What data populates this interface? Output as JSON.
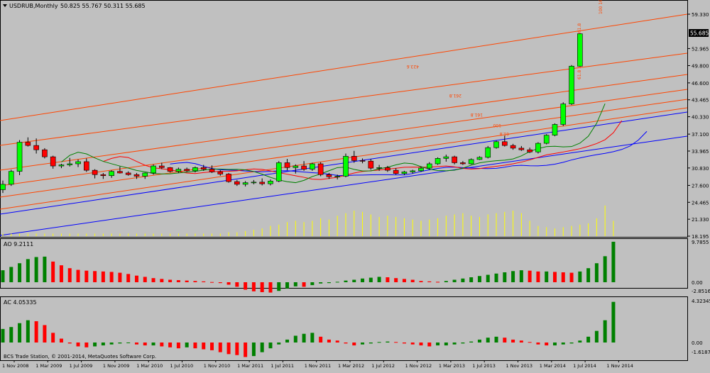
{
  "panels": {
    "main": {
      "title": "USDRUB,Monthly",
      "ohlc": "50.825 55.767 50.311 55.685"
    },
    "ao": {
      "title": "AO 9.2111"
    },
    "ac": {
      "title": "AC 4.05335"
    }
  },
  "axes": {
    "main_ticks": [
      "59.330",
      "55.685",
      "52.965",
      "49.800",
      "46.600",
      "43.465",
      "40.330",
      "37.100",
      "33.965",
      "30.830",
      "27.600",
      "24.465",
      "21.330",
      "18.195"
    ],
    "ao_ticks": [
      "9.7855",
      "0.00",
      "-2.8516"
    ],
    "ac_ticks": [
      "4.32345",
      "0.00",
      "-1.61871"
    ],
    "current_price": "55.685",
    "x_ticks": [
      "1 Nov 2008",
      "1 Mar 2009",
      "1 Jul 2009",
      "1 Nov 2009",
      "1 Mar 2010",
      "1 Jul 2010",
      "1 Nov 2010",
      "1 Mar 2011",
      "1 Jul 2011",
      "1 Nov 2011",
      "1 Mar 2012",
      "1 Jul 2012",
      "1 Nov 2012",
      "1 Mar 2013",
      "1 Jul 2013",
      "1 Nov 2013",
      "1 Mar 2014",
      "1 Jul 2014",
      "1 Nov 2014"
    ]
  },
  "fib_labels": [
    "423.6",
    "261.8",
    "161.8",
    "100",
    "61.8",
    "261.8",
    "161.8",
    "100",
    "61.8",
    "100 161.8 261.8"
  ],
  "copyright": "BCS Trade Station, © 2001-2014, MetaQuotes Software Corp.",
  "colors": {
    "bull": "#00ff00",
    "bear": "#ff0000",
    "fib": "#ff4500",
    "blue": "#0000ff",
    "volume": "#ffff00",
    "ao_up": "#008000",
    "ao_down": "#ff0000"
  },
  "chart_data": {
    "type": "candlestick",
    "months_shown": 74,
    "candles": [
      [
        26.8,
        28.5,
        26.2,
        27.8
      ],
      [
        27.8,
        30.5,
        27.5,
        30.2
      ],
      [
        30.2,
        36.0,
        29.5,
        35.6
      ],
      [
        35.6,
        36.5,
        34.8,
        35.0
      ],
      [
        35.0,
        36.3,
        33.5,
        34.2
      ],
      [
        34.2,
        34.5,
        32.6,
        32.9
      ],
      [
        32.9,
        33.1,
        30.7,
        31.2
      ],
      [
        31.2,
        31.6,
        30.8,
        31.4
      ],
      [
        31.4,
        32.7,
        31.1,
        31.6
      ],
      [
        31.6,
        32.4,
        31.0,
        32.0
      ],
      [
        32.0,
        32.6,
        30.1,
        30.4
      ],
      [
        30.4,
        30.6,
        28.9,
        29.6
      ],
      [
        29.6,
        29.9,
        28.8,
        29.4
      ],
      [
        29.4,
        30.4,
        29.0,
        30.2
      ],
      [
        30.2,
        31.1,
        29.8,
        29.9
      ],
      [
        29.9,
        30.2,
        29.4,
        29.6
      ],
      [
        29.6,
        29.9,
        28.8,
        29.3
      ],
      [
        29.3,
        30.0,
        28.8,
        29.9
      ],
      [
        29.9,
        31.5,
        29.6,
        31.2
      ],
      [
        31.2,
        31.8,
        30.6,
        30.9
      ],
      [
        30.9,
        31.0,
        30.0,
        30.2
      ],
      [
        30.2,
        30.9,
        29.9,
        30.6
      ],
      [
        30.6,
        30.9,
        30.1,
        30.3
      ],
      [
        30.3,
        31.1,
        30.0,
        30.9
      ],
      [
        30.9,
        31.4,
        30.3,
        30.6
      ],
      [
        30.6,
        31.3,
        29.9,
        30.1
      ],
      [
        30.1,
        30.4,
        29.4,
        29.7
      ],
      [
        29.7,
        29.9,
        28.1,
        28.3
      ],
      [
        28.3,
        28.6,
        27.5,
        27.8
      ],
      [
        27.8,
        28.4,
        27.4,
        28.1
      ],
      [
        28.1,
        28.6,
        27.8,
        28.2
      ],
      [
        28.2,
        28.9,
        27.6,
        27.9
      ],
      [
        27.9,
        28.7,
        27.6,
        28.4
      ],
      [
        28.4,
        32.1,
        28.2,
        31.8
      ],
      [
        31.8,
        32.5,
        30.4,
        30.9
      ],
      [
        30.9,
        31.5,
        29.8,
        31.2
      ],
      [
        31.2,
        32.1,
        30.3,
        30.6
      ],
      [
        30.6,
        31.8,
        30.3,
        31.6
      ],
      [
        31.6,
        31.9,
        29.3,
        29.6
      ],
      [
        29.6,
        29.9,
        28.8,
        29.2
      ],
      [
        29.2,
        29.6,
        28.7,
        29.3
      ],
      [
        29.3,
        33.5,
        29.1,
        33.0
      ],
      [
        33.0,
        34.0,
        31.8,
        32.2
      ],
      [
        32.2,
        32.6,
        31.7,
        32.1
      ],
      [
        32.1,
        32.5,
        30.5,
        30.8
      ],
      [
        30.8,
        31.4,
        30.3,
        30.9
      ],
      [
        30.9,
        31.2,
        30.1,
        30.4
      ],
      [
        30.4,
        30.8,
        29.6,
        29.8
      ],
      [
        29.8,
        30.3,
        29.5,
        30.1
      ],
      [
        30.1,
        30.5,
        29.8,
        30.3
      ],
      [
        30.3,
        31.1,
        30.1,
        30.8
      ],
      [
        30.8,
        31.9,
        30.6,
        31.6
      ],
      [
        31.6,
        32.8,
        31.4,
        32.6
      ],
      [
        32.6,
        33.3,
        32.0,
        32.9
      ],
      [
        32.9,
        33.1,
        31.5,
        31.8
      ],
      [
        31.8,
        32.1,
        31.4,
        31.6
      ],
      [
        31.6,
        32.6,
        31.5,
        32.4
      ],
      [
        32.4,
        33.0,
        32.3,
        32.8
      ],
      [
        32.8,
        34.9,
        32.6,
        34.6
      ],
      [
        34.6,
        35.9,
        34.4,
        35.7
      ],
      [
        35.7,
        36.8,
        34.8,
        35.0
      ],
      [
        35.0,
        35.3,
        34.2,
        34.5
      ],
      [
        34.5,
        34.9,
        34.0,
        34.2
      ],
      [
        34.2,
        34.6,
        33.6,
        33.8
      ],
      [
        33.8,
        35.6,
        33.5,
        35.4
      ],
      [
        35.4,
        37.1,
        35.2,
        36.9
      ],
      [
        36.9,
        39.1,
        36.7,
        38.9
      ],
      [
        38.9,
        43.0,
        38.6,
        42.7
      ],
      [
        42.7,
        49.9,
        42.5,
        49.7
      ],
      [
        49.7,
        55.8,
        49.6,
        55.7
      ]
    ],
    "ao_values": [
      2.9,
      3.7,
      4.6,
      5.6,
      6.1,
      6.2,
      5.0,
      4.1,
      3.4,
      3.0,
      2.8,
      2.7,
      2.6,
      2.5,
      2.3,
      2.0,
      1.6,
      1.3,
      1.0,
      0.8,
      0.6,
      0.5,
      0.4,
      0.3,
      0.2,
      0.05,
      -0.2,
      -0.6,
      -1.1,
      -1.8,
      -2.2,
      -2.4,
      -2.5,
      -2.1,
      -1.5,
      -1.0,
      -1.1,
      -0.7,
      -0.3,
      -0.2,
      0.1,
      0.4,
      0.6,
      0.9,
      1.1,
      1.3,
      1.2,
      1.0,
      0.8,
      0.6,
      0.3,
      0.2,
      0.1,
      0.3,
      0.6,
      0.9,
      1.2,
      1.5,
      1.8,
      2.1,
      2.4,
      2.7,
      2.9,
      2.8,
      2.6,
      2.6,
      2.5,
      2.4,
      2.3,
      2.6,
      3.4,
      4.6,
      6.3,
      9.8
    ],
    "ac_values": [
      1.4,
      1.6,
      2.0,
      2.3,
      2.2,
      1.8,
      1.0,
      0.4,
      -0.1,
      -0.4,
      -0.5,
      -0.4,
      -0.3,
      -0.2,
      -0.1,
      -0.05,
      -0.2,
      -0.3,
      -0.3,
      -0.4,
      -0.5,
      -0.6,
      -0.5,
      -0.6,
      -0.7,
      -0.8,
      -1.0,
      -1.2,
      -1.3,
      -1.5,
      -1.4,
      -1.0,
      -0.6,
      -0.2,
      0.3,
      0.7,
      0.9,
      1.0,
      0.6,
      0.3,
      0.2,
      -0.1,
      -0.3,
      -0.2,
      -0.1,
      0.05,
      0.1,
      0.05,
      -0.1,
      -0.2,
      -0.3,
      -0.4,
      -0.3,
      -0.3,
      -0.2,
      -0.1,
      0.1,
      0.3,
      0.5,
      0.6,
      0.5,
      0.3,
      0.2,
      0.05,
      -0.2,
      -0.3,
      -0.3,
      -0.2,
      -0.1,
      0.2,
      0.6,
      1.2,
      2.3,
      4.2
    ],
    "volume": [
      0.1,
      0.1,
      0.1,
      0.1,
      0.1,
      0.1,
      0.1,
      0.1,
      0.1,
      0.1,
      0.1,
      0.1,
      0.1,
      0.1,
      0.1,
      0.1,
      0.1,
      0.1,
      0.1,
      0.1,
      0.1,
      0.1,
      0.1,
      0.1,
      0.1,
      0.1,
      0.1,
      0.15,
      0.15,
      0.2,
      0.25,
      0.3,
      0.4,
      0.45,
      0.55,
      0.6,
      0.55,
      0.6,
      0.7,
      0.65,
      0.8,
      0.9,
      1.0,
      0.95,
      0.85,
      0.75,
      0.8,
      0.75,
      0.7,
      0.65,
      0.6,
      0.65,
      0.7,
      0.8,
      0.85,
      0.9,
      0.8,
      0.75,
      0.85,
      0.9,
      0.95,
      1.0,
      0.9,
      0.6,
      0.4,
      0.35,
      0.3,
      0.35,
      0.4,
      0.45,
      0.5,
      0.7,
      1.2,
      0.6
    ]
  }
}
